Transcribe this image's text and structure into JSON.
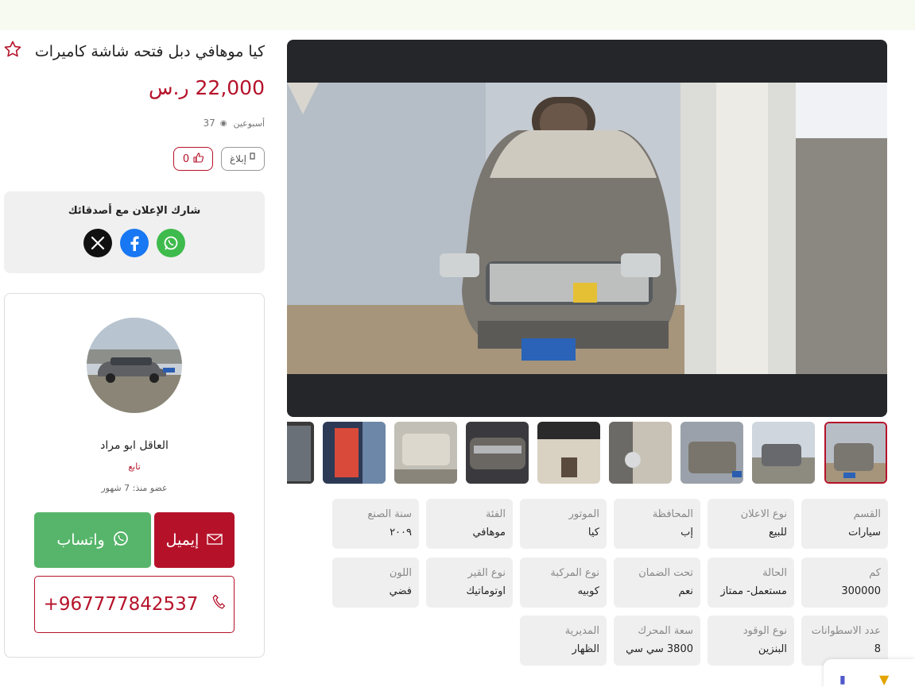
{
  "listing": {
    "title": "كيا موهافي دبل فتحه شاشة كاميرات",
    "price": "22,000 ر.س",
    "posted": "أسبوعين",
    "views": "37",
    "report_label": "إبلاغ",
    "likes": "0"
  },
  "share": {
    "title": "شارك الإعلان مع أصدقائك",
    "networks": [
      "x-icon",
      "facebook-icon",
      "whatsapp-icon"
    ]
  },
  "seller": {
    "name": "العاقل ابو مراد",
    "follow_label": "تابع",
    "member_since": "عضو منذ: 7 شهور",
    "whatsapp_label": "واتساب",
    "email_label": "إيميل",
    "phone": "+967777842537"
  },
  "specs": [
    {
      "label": "القسم",
      "value": "سيارات"
    },
    {
      "label": "نوع الاعلان",
      "value": "للبيع"
    },
    {
      "label": "المحافظة",
      "value": "إب"
    },
    {
      "label": "الموتور",
      "value": "كيا"
    },
    {
      "label": "الفئة",
      "value": "موهافي"
    },
    {
      "label": "سنة الصنع",
      "value": "٢٠٠٩"
    },
    {
      "label": "كم",
      "value": "300000"
    },
    {
      "label": "الحالة",
      "value": "مستعمل- ممتاز"
    },
    {
      "label": "تحت الضمان",
      "value": "نعم"
    },
    {
      "label": "نوع المركبة",
      "value": "كوبيه"
    },
    {
      "label": "نوع القير",
      "value": "اوتوماتيك"
    },
    {
      "label": "اللون",
      "value": "فضي"
    },
    {
      "label": "عدد الاسطوانات",
      "value": "8"
    },
    {
      "label": "نوع الوقود",
      "value": "البنزين"
    },
    {
      "label": "سعة المحرك",
      "value": "3800 سي سي"
    },
    {
      "label": "المديرية",
      "value": "الظهار"
    }
  ],
  "colors": {
    "brand": "#b5122a",
    "whatsapp": "#56b56a",
    "spec_bg": "#efefef"
  }
}
